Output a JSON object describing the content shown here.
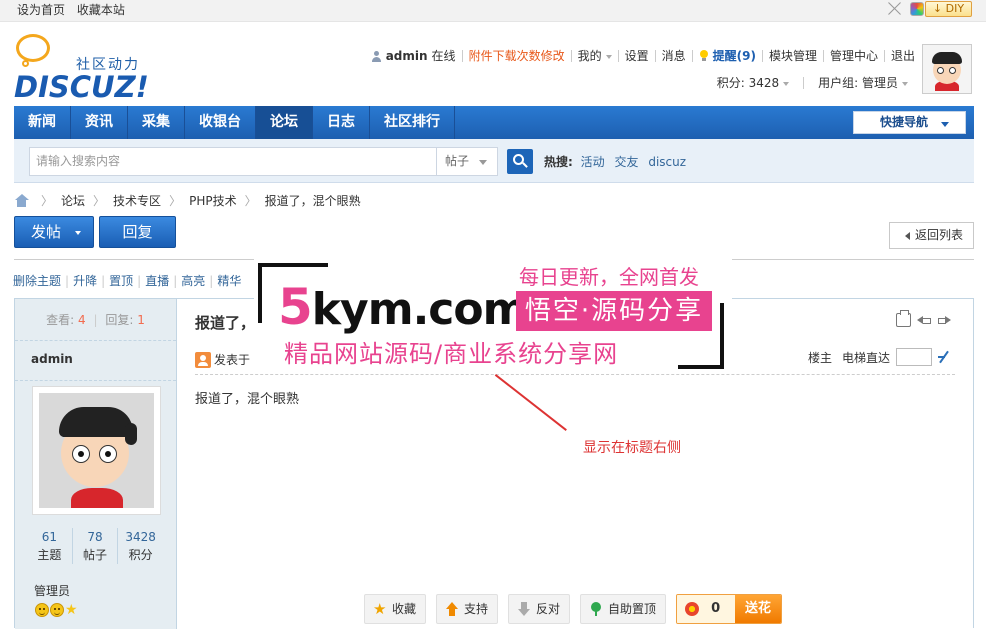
{
  "topbar": {
    "set_home": "设为首页",
    "bookmark": "收藏本站",
    "diy": "DIY"
  },
  "logo": {
    "sub": "社区动力",
    "main": "DISCUZ!"
  },
  "user": {
    "name": "admin",
    "online": "在线",
    "links": [
      "附件下载次数修改",
      "我的",
      "设置",
      "消息"
    ],
    "remind": "提醒(9)",
    "links2": [
      "模块管理",
      "管理中心",
      "退出"
    ],
    "points": "积分: 3428",
    "group": "用户组: 管理员"
  },
  "nav": {
    "items": [
      "新闻",
      "资讯",
      "采集",
      "收银台",
      "论坛",
      "日志",
      "社区排行"
    ],
    "active": "论坛",
    "quick": "快捷导航"
  },
  "search": {
    "placeholder": "请输入搜索内容",
    "type": "帖子",
    "hot_label": "热搜:",
    "hot": [
      "活动",
      "交友",
      "discuz"
    ]
  },
  "breadcrumb": [
    "论坛",
    "技术专区",
    "PHP技术",
    "报道了，混个眼熟"
  ],
  "buttons": {
    "post": "发帖",
    "reply": "回复",
    "back": "返回列表"
  },
  "modbar": [
    "删除主题",
    "升降",
    "置顶",
    "直播",
    "高亮",
    "精华"
  ],
  "thread": {
    "views_label": "查看:",
    "views": "4",
    "replies_label": "回复:",
    "replies": "1",
    "author": "admin",
    "title": "报道了，",
    "posted": "发表于",
    "floor": "楼主",
    "jump": "电梯直达",
    "body": "报道了，混个眼熟"
  },
  "profile": {
    "stats": [
      {
        "n": "61",
        "label": "主题"
      },
      {
        "n": "78",
        "label": "帖子"
      },
      {
        "n": "3428",
        "label": "积分"
      }
    ],
    "group": "管理员"
  },
  "watermark": {
    "brand_digit": "5",
    "brand_rest": "kym.com",
    "tagline": "每日更新，全网首发",
    "box": "悟空·源码分享",
    "slogan": "精品网站源码/商业系统分享网"
  },
  "annotation": "显示在标题右侧",
  "actions": {
    "fav": "收藏",
    "support": "支持",
    "oppose": "反对",
    "pin": "自助置顶",
    "flower_count": "0",
    "flower": "送花"
  },
  "colors": {
    "nav": "#1d5fb0",
    "accent_pink": "#e8438f",
    "annotation": "#dd3333"
  }
}
